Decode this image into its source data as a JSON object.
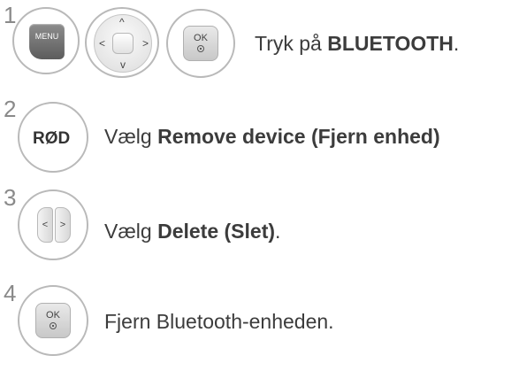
{
  "steps": [
    {
      "number": "1",
      "text_plain": "Tryk på ",
      "text_bold": "BLUETOOTH",
      "text_after": ".",
      "keys": {
        "menu": "MENU",
        "ok": "OK"
      }
    },
    {
      "number": "2",
      "key_label": "RØD",
      "text_plain": "Vælg ",
      "text_bold": "Remove device (Fjern enhed)",
      "text_after": ""
    },
    {
      "number": "3",
      "text_plain": "Vælg ",
      "text_bold": "Delete (Slet)",
      "text_after": "."
    },
    {
      "number": "4",
      "text_plain": "Fjern Bluetooth-enheden.",
      "keys": {
        "ok": "OK"
      }
    }
  ],
  "nav_arrows": {
    "up": "^",
    "down": "v",
    "left": "<",
    "right": ">"
  }
}
